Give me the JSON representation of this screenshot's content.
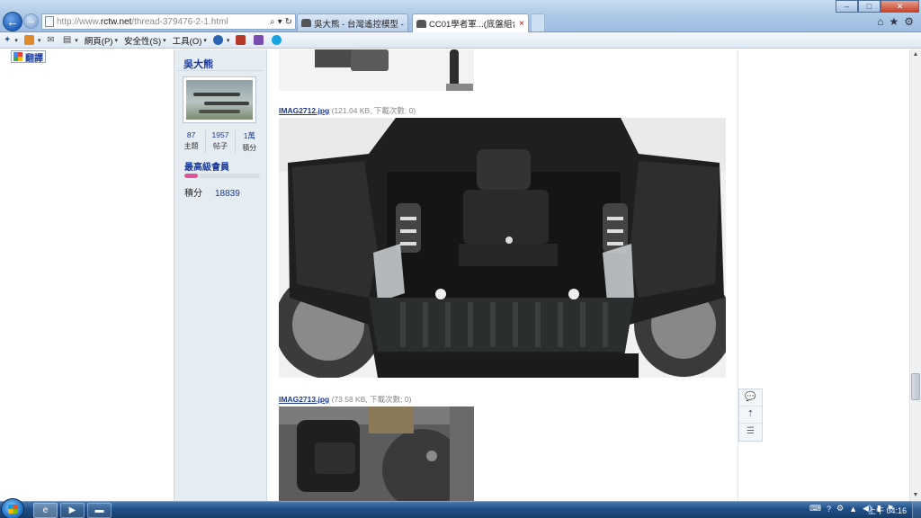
{
  "browser": {
    "address": {
      "prefix": "http://www.",
      "domain": "rctw.net",
      "path": "/thread-379476-2-1.html"
    },
    "tabs": [
      {
        "label": "吳大熊 - 台灣遙控模型 - RC T...",
        "active": false
      },
      {
        "label": "CC01學者軍...(底盤組合臉...",
        "active": true
      }
    ],
    "tab_close": "×",
    "window_controls": {
      "minimize": "–",
      "maximize": "□",
      "close": "✕"
    },
    "command_bar": {
      "page": "網頁(P)",
      "safety": "安全性(S)",
      "tools": "工具(O)"
    }
  },
  "page": {
    "translate_button": "翻譯",
    "user": {
      "name": "吳大熊",
      "stats": [
        {
          "value": "87",
          "label": "主題"
        },
        {
          "value": "1957",
          "label": "帖子"
        },
        {
          "value": "1萬",
          "label": "積分"
        }
      ],
      "rank": "最高級會員",
      "rank_progress": 0.18,
      "points_label": "積分",
      "points_value": "18839"
    },
    "attachments": [
      {
        "filename": "IMAG2712.jpg",
        "meta": "(121.04 KB, 下載次數: 0)"
      },
      {
        "filename": "IMAG2713.jpg",
        "meta": "(73.58 KB, 下載次數: 0)"
      }
    ]
  },
  "taskbar": {
    "clock": "上午 04:16"
  },
  "colors": {
    "accent": "#1b3a9c",
    "sidebar_bg": "#e5edf2",
    "rank_bar": "#e0559a"
  }
}
